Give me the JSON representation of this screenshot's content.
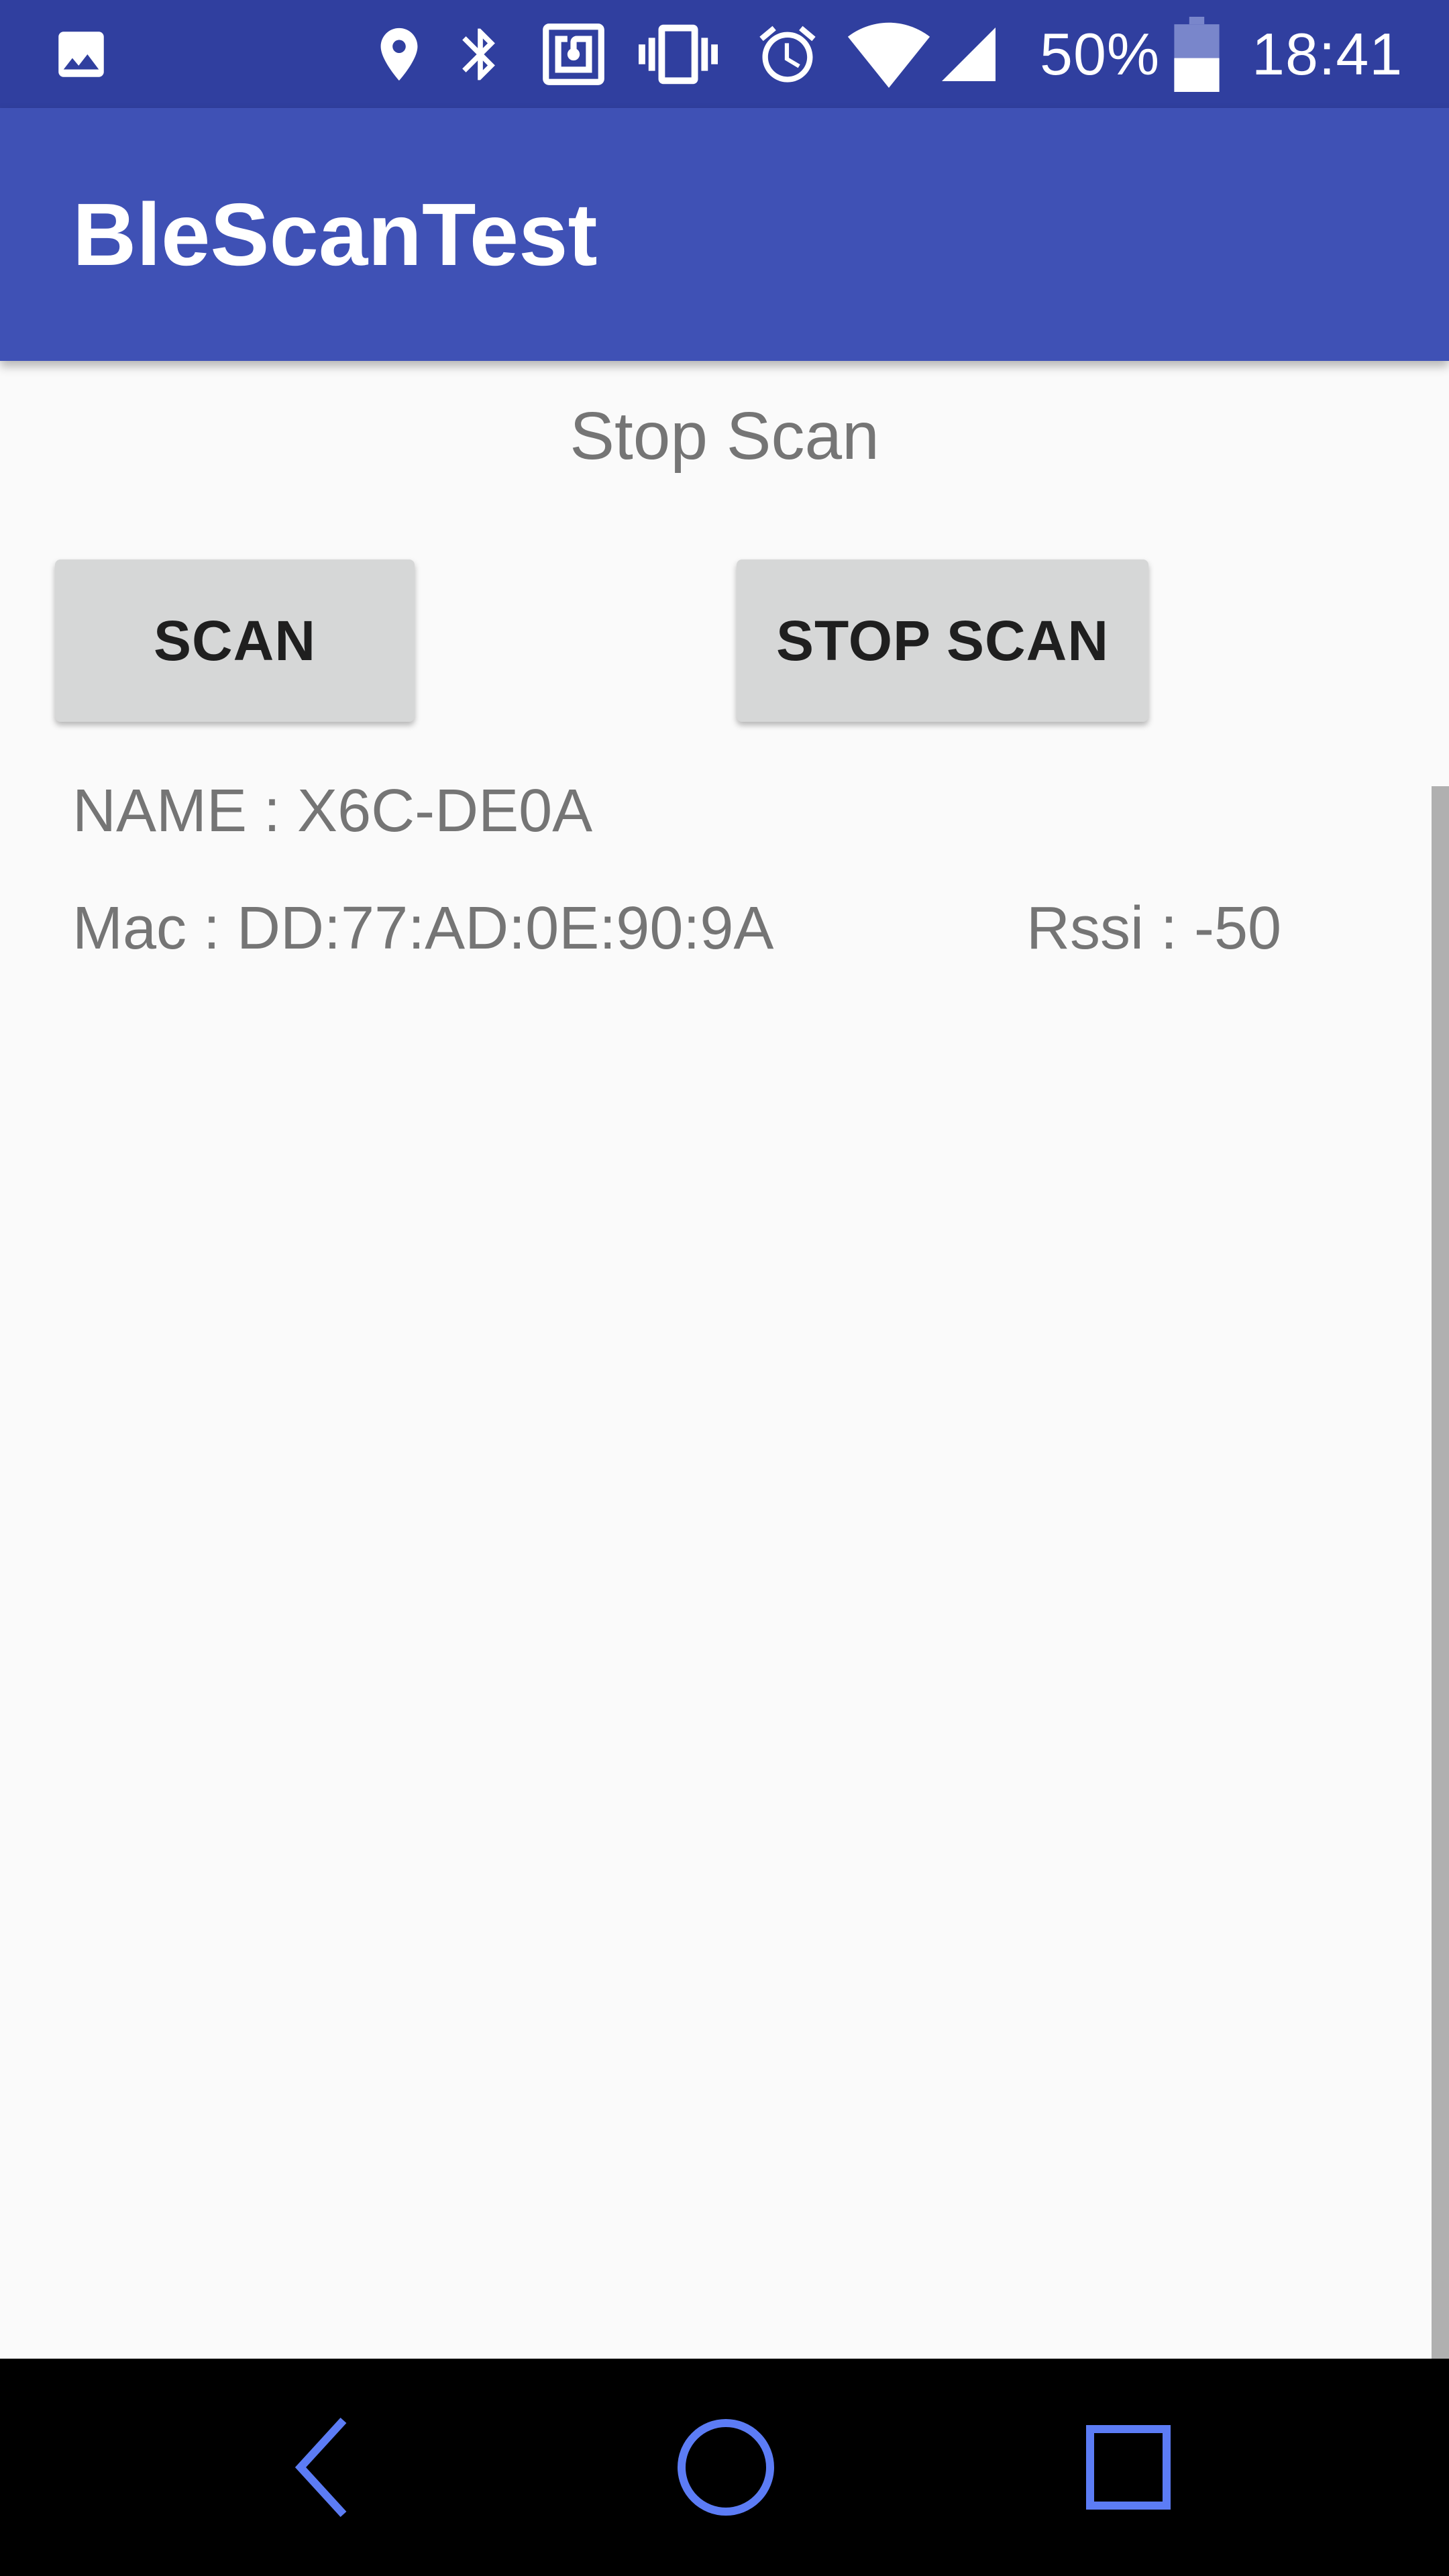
{
  "status_bar": {
    "battery_percent": "50%",
    "time": "18:41",
    "icons": [
      "image-icon",
      "location-icon",
      "bluetooth-icon",
      "nfc-icon",
      "vibrate-icon",
      "alarm-icon",
      "wifi-icon",
      "signal-icon",
      "battery-icon"
    ],
    "battery_level": 0.5,
    "color": "#303f9f"
  },
  "app_bar": {
    "title": "BleScanTest",
    "color": "#3f51b5"
  },
  "main": {
    "status_text": "Stop Scan",
    "scan_button": "SCAN",
    "stop_scan_button": "STOP SCAN",
    "devices": [
      {
        "name": "NAME : X6C-DE0A",
        "mac": "Mac : DD:77:AD:0E:90:9A",
        "rssi": "Rssi : -50"
      }
    ]
  },
  "nav_bar": {
    "icons": [
      "back-icon",
      "home-icon",
      "recents-icon"
    ],
    "icon_color": "#5c7cf5"
  }
}
